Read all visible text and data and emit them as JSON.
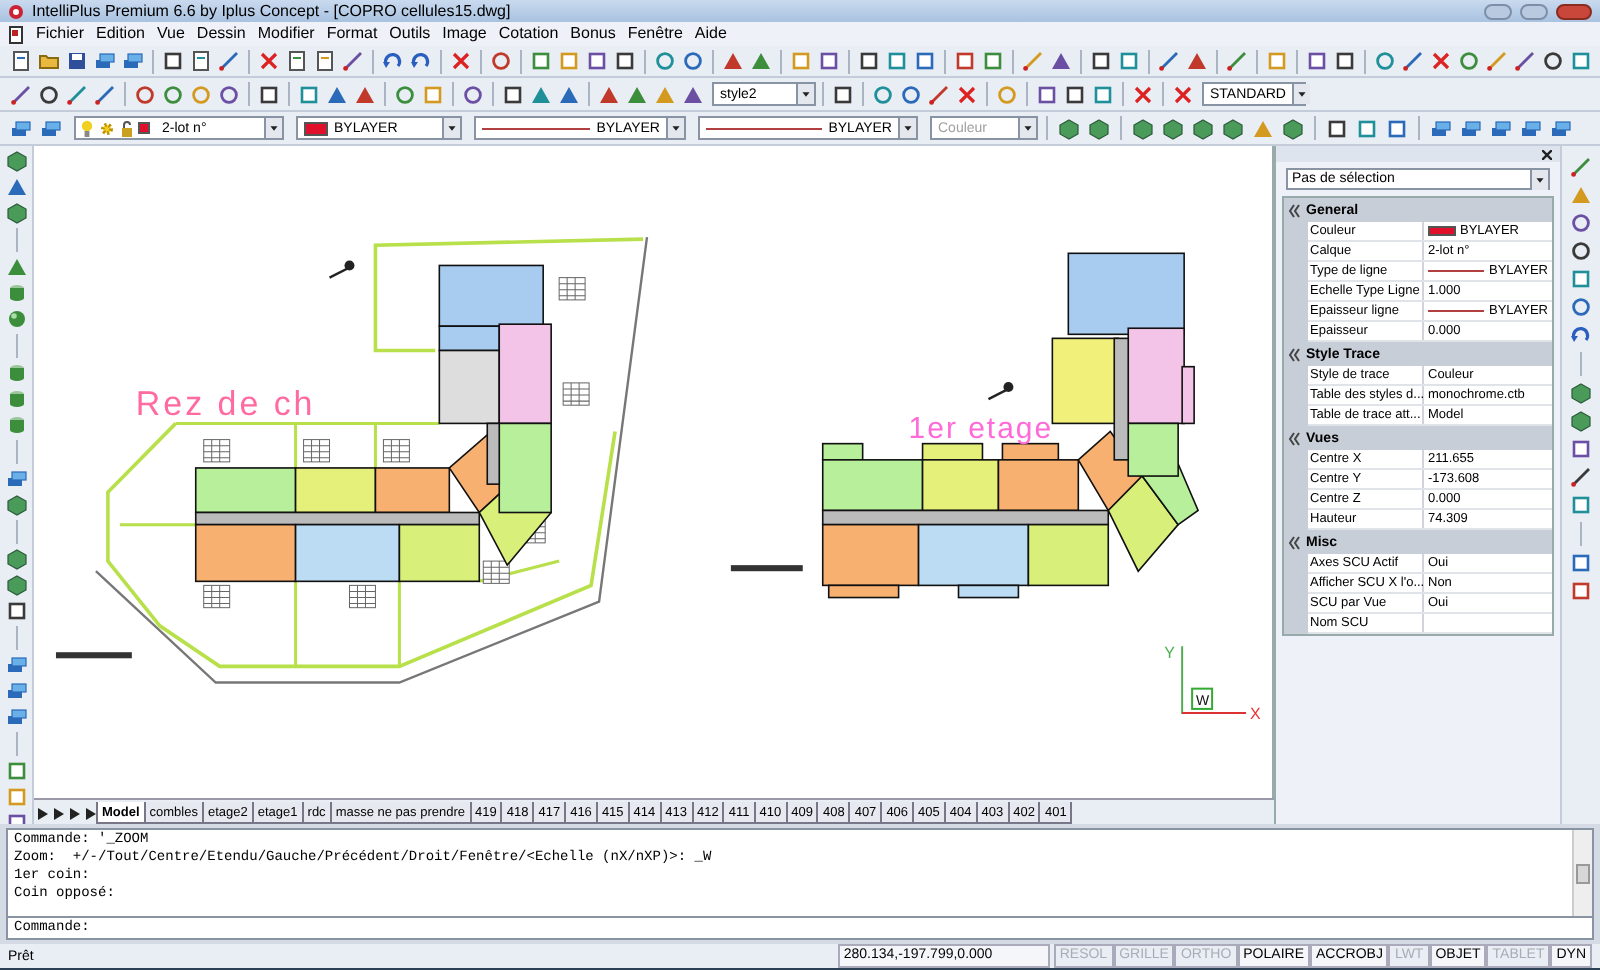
{
  "window": {
    "title": "IntelliPlus  Premium 6.6  by Iplus Concept - [COPRO cellules15.dwg]"
  },
  "menu": [
    "Fichier",
    "Edition",
    "Vue",
    "Dessin",
    "Modifier",
    "Format",
    "Outils",
    "Image",
    "Cotation",
    "Bonus",
    "Fenêtre",
    "Aide"
  ],
  "toolbars": {
    "text_style": "style2",
    "dim_style": "STANDARD",
    "layer": "2-lot n°",
    "color": {
      "value": "BYLAYER",
      "color": "#e0102a"
    },
    "linetype": "BYLAYER",
    "lineweight": "BYLAYER",
    "plot_style": {
      "value": "Couleur",
      "disabled": true
    }
  },
  "drawing": {
    "labels": [
      "Rez de ch",
      "1er etage"
    ],
    "ucs": {
      "y": "Y",
      "x": "X",
      "w": "W"
    }
  },
  "properties": {
    "selection": "Pas de sélection",
    "sections": [
      {
        "title": "General",
        "rows": [
          {
            "name": "Couleur",
            "value": "BYLAYER",
            "kind": "color",
            "color": "#e0102a"
          },
          {
            "name": "Calque",
            "value": "2-lot n°",
            "kind": "text"
          },
          {
            "name": "Type de ligne",
            "value": "BYLAYER",
            "kind": "line"
          },
          {
            "name": "Echelle Type Ligne",
            "value": "1.000",
            "kind": "text"
          },
          {
            "name": "Epaisseur ligne",
            "value": "BYLAYER",
            "kind": "line"
          },
          {
            "name": "Epaisseur",
            "value": "0.000",
            "kind": "text"
          }
        ]
      },
      {
        "title": "Style Trace",
        "rows": [
          {
            "name": "Style de trace",
            "value": "Couleur",
            "kind": "text"
          },
          {
            "name": "Table des styles d...",
            "value": "monochrome.ctb",
            "kind": "text"
          },
          {
            "name": "Table de trace att...",
            "value": "Model",
            "kind": "text"
          }
        ]
      },
      {
        "title": "Vues",
        "rows": [
          {
            "name": "Centre X",
            "value": "211.655",
            "kind": "text"
          },
          {
            "name": "Centre Y",
            "value": "-173.608",
            "kind": "text"
          },
          {
            "name": "Centre Z",
            "value": "0.000",
            "kind": "text"
          },
          {
            "name": "Hauteur",
            "value": "74.309",
            "kind": "text"
          }
        ]
      },
      {
        "title": "Misc",
        "rows": [
          {
            "name": "Axes SCU Actif",
            "value": "Oui",
            "kind": "text"
          },
          {
            "name": "Afficher SCU X l'o...",
            "value": "Non",
            "kind": "text"
          },
          {
            "name": "SCU par Vue",
            "value": "Oui",
            "kind": "text"
          },
          {
            "name": "Nom SCU",
            "kind": "text"
          }
        ]
      }
    ]
  },
  "layout_tabs": [
    {
      "label": "Model",
      "selected": true
    },
    {
      "label": "combles",
      "selected": false
    },
    {
      "label": "etage2",
      "selected": false
    },
    {
      "label": "etage1",
      "selected": false
    },
    {
      "label": "rdc",
      "selected": false
    },
    {
      "label": "masse ne pas prendre",
      "selected": false
    },
    {
      "label": "419",
      "selected": false
    },
    {
      "label": "418",
      "selected": false
    },
    {
      "label": "417",
      "selected": false
    },
    {
      "label": "416",
      "selected": false
    },
    {
      "label": "415",
      "selected": false
    },
    {
      "label": "414",
      "selected": false
    },
    {
      "label": "413",
      "selected": false
    },
    {
      "label": "412",
      "selected": false
    },
    {
      "label": "411",
      "selected": false
    },
    {
      "label": "410",
      "selected": false
    },
    {
      "label": "409",
      "selected": false
    },
    {
      "label": "408",
      "selected": false
    },
    {
      "label": "407",
      "selected": false
    },
    {
      "label": "406",
      "selected": false
    },
    {
      "label": "405",
      "selected": false
    },
    {
      "label": "404",
      "selected": false
    },
    {
      "label": "403",
      "selected": false
    },
    {
      "label": "402",
      "selected": false
    },
    {
      "label": "401",
      "selected": false
    }
  ],
  "command": {
    "history": [
      "Commande: '_ZOOM",
      "Zoom:  +/-/Tout/Centre/Etendu/Gauche/Précédent/Droit/Fenêtre/<Echelle (nX/nXP)>: _W",
      "1er coin:",
      "Coin opposé:"
    ],
    "prompt": "Commande:"
  },
  "status_bar": {
    "text": "Prêt",
    "coords": "280.134,-197.799,0.000",
    "toggles": [
      {
        "label": "RESOL",
        "on": false
      },
      {
        "label": "GRILLE",
        "on": false
      },
      {
        "label": "ORTHO",
        "on": false
      },
      {
        "label": "POLAIRE",
        "on": true
      },
      {
        "label": "ACCROBJ",
        "on": true
      },
      {
        "label": "LWT",
        "on": false
      },
      {
        "label": "OBJET",
        "on": true
      },
      {
        "label": "TABLET",
        "on": false
      },
      {
        "label": "DYN",
        "on": true
      }
    ]
  }
}
